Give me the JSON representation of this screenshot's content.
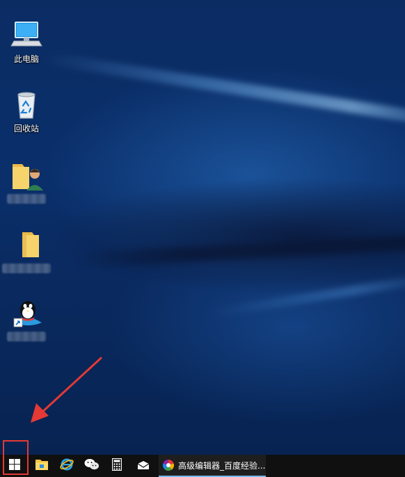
{
  "desktop": {
    "icons": [
      {
        "label": "此电脑",
        "icon": "this-pc-icon"
      },
      {
        "label": "回收站",
        "icon": "recycle-bin-icon"
      },
      {
        "label": "",
        "icon": "user-folder-icon"
      },
      {
        "label": "",
        "icon": "folder-icon"
      },
      {
        "label": "",
        "icon": "qq-icon"
      }
    ]
  },
  "taskbar": {
    "start": {
      "icon": "windows-start-icon"
    },
    "pinned": [
      {
        "icon": "file-explorer-icon"
      },
      {
        "icon": "internet-explorer-icon"
      },
      {
        "icon": "wechat-icon"
      },
      {
        "icon": "calculator-icon"
      },
      {
        "icon": "mail-icon"
      }
    ],
    "active_task": {
      "title": "高级编辑器_百度经验...",
      "icon": "browser-icon"
    }
  },
  "colors": {
    "highlight": "#e53935",
    "taskbar": "#101010",
    "accent": "#76b9ed"
  }
}
